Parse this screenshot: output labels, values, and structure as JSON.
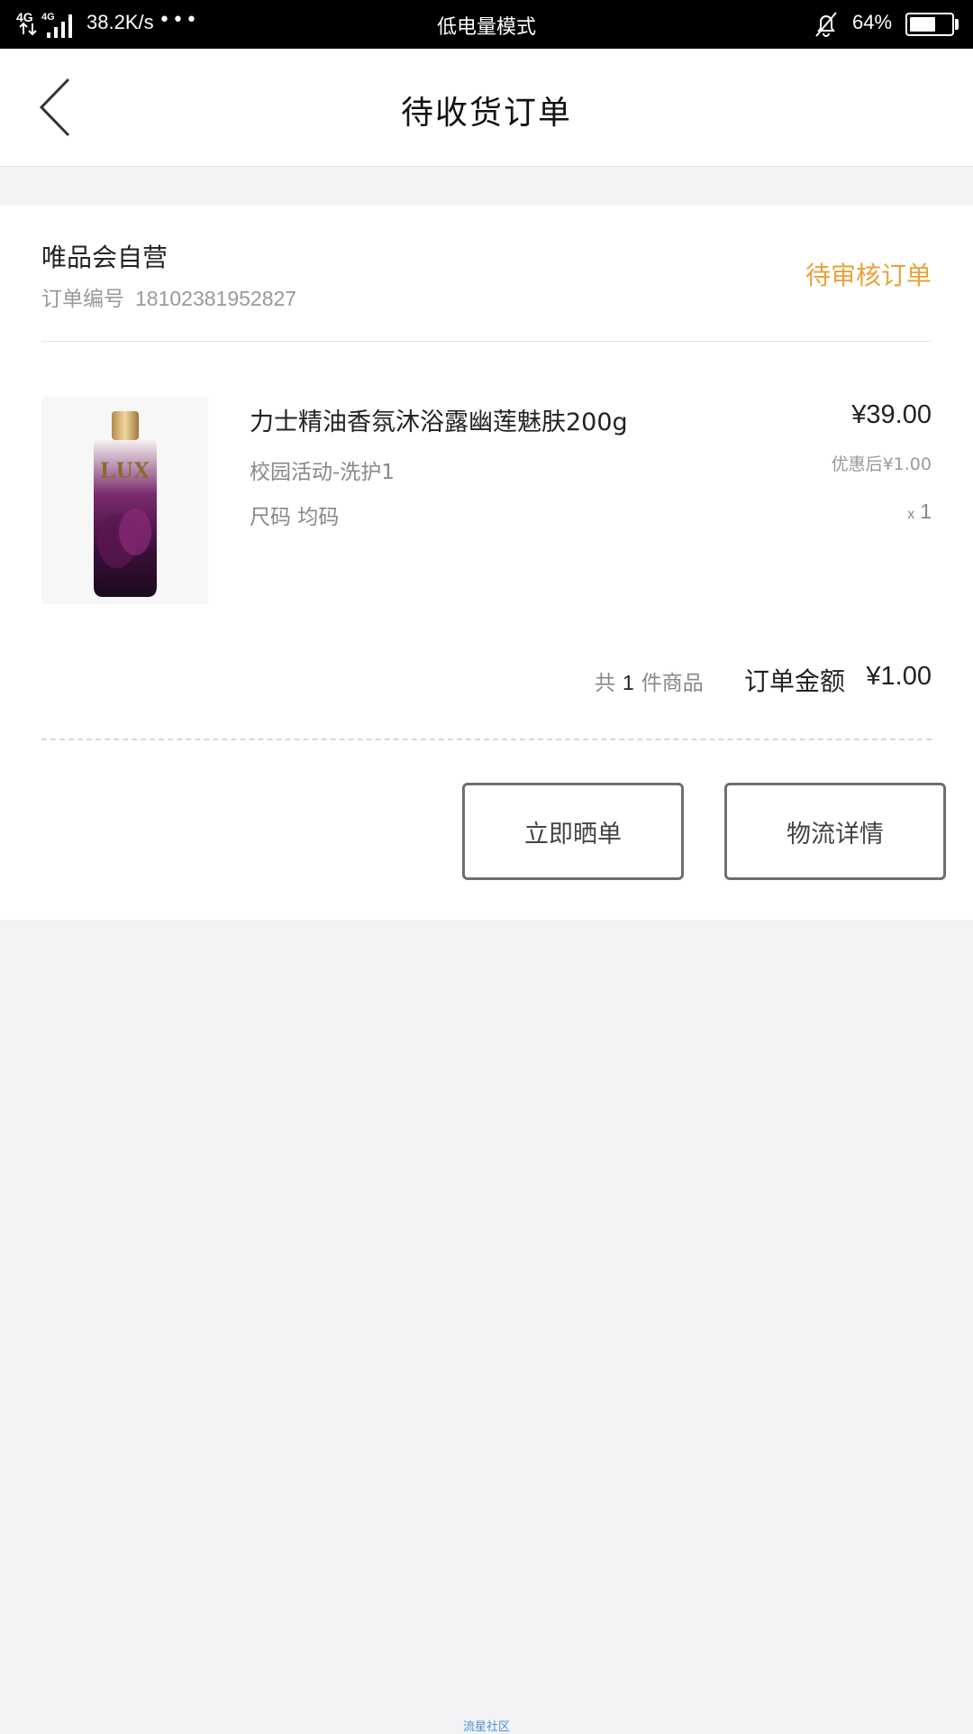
{
  "status_bar": {
    "network_left": "4G",
    "network_right": "4G",
    "speed": "38.2K/s",
    "dots": "•••",
    "mode": "低电量模式",
    "battery_percent": "64%",
    "battery_level": 0.64
  },
  "header": {
    "title": "待收货订单"
  },
  "order": {
    "store_name": "唯品会自营",
    "order_no_label": "订单编号",
    "order_no": "18102381952827",
    "status": "待审核订单",
    "product": {
      "name": "力士精油香氛沐浴露幽莲魅肤200g",
      "promo": "校园活动-洗护1",
      "size": "尺码 均码",
      "price": "¥39.00",
      "after_discount": "优惠后¥1.00",
      "qty_prefix": "x",
      "qty": "1",
      "image_brand": "LUX"
    },
    "summary": {
      "count_prefix": "共",
      "count": "1",
      "count_suffix": "件商品",
      "total_label": "订单金额",
      "total": "¥1.00"
    },
    "actions": {
      "review": "立即晒单",
      "logistics": "物流详情"
    }
  },
  "footer": {
    "mark": "流星社区"
  },
  "colors": {
    "status_accent": "#e8a23a",
    "page_bg": "#f2f3f5",
    "footer_link": "#4a90d9"
  },
  "icons": {
    "back": "chevron-left-icon",
    "bell": "bell-off-icon",
    "signal": "signal-icon",
    "battery": "battery-icon"
  }
}
